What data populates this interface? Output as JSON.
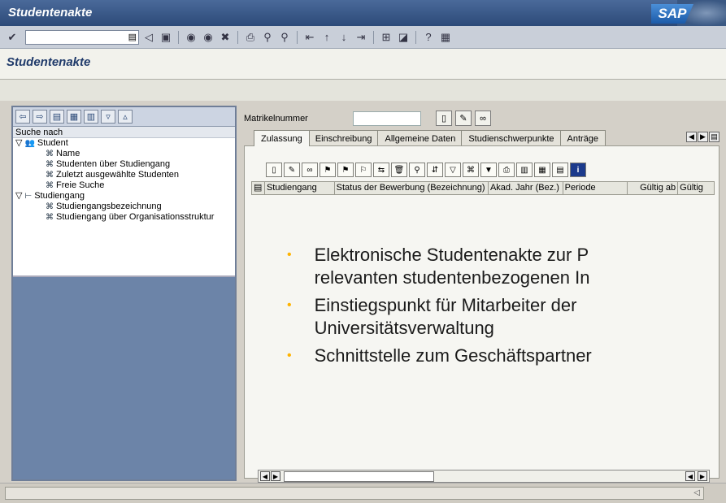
{
  "window": {
    "title": "Studentenakte",
    "logo": "SAP"
  },
  "toolbar": {
    "icons": [
      "enter-icon",
      "dropdown-icon",
      "back-arrow-icon",
      "save-icon",
      "back-icon",
      "exit-icon",
      "cancel-icon",
      "print-icon",
      "find-icon",
      "find-next-icon",
      "first-page-icon",
      "prev-page-icon",
      "next-page-icon",
      "last-page-icon",
      "new-session-icon",
      "shortcut-icon",
      "help-icon",
      "layout-icon"
    ]
  },
  "screen_title": "Studentenakte",
  "left": {
    "search_label": "Suche nach",
    "tree": [
      {
        "label": "Student",
        "level": 0,
        "icon": "student-icon"
      },
      {
        "label": "Name",
        "level": 1,
        "icon": "binoculars-icon"
      },
      {
        "label": "Studenten über Studiengang",
        "level": 1,
        "icon": "binoculars-icon"
      },
      {
        "label": "Zuletzt ausgewählte Studenten",
        "level": 1,
        "icon": "binoculars-icon"
      },
      {
        "label": "Freie Suche",
        "level": 1,
        "icon": "binoculars-icon"
      },
      {
        "label": "Studiengang",
        "level": 0,
        "icon": "structure-icon"
      },
      {
        "label": "Studiengangsbezeichnung",
        "level": 1,
        "icon": "binoculars-icon"
      },
      {
        "label": "Studiengang über Organisationsstruktur",
        "level": 1,
        "icon": "binoculars-icon"
      }
    ]
  },
  "right": {
    "matrikel_label": "Matrikelnummer",
    "matrikel_value": "",
    "tabs": [
      "Zulassung",
      "Einschreibung",
      "Allgemeine Daten",
      "Studienschwerpunkte",
      "Anträge"
    ],
    "active_tab": "Zulassung",
    "columns": [
      "Studiengang",
      "Status der Bewerbung (Bezeichnung)",
      "Akad. Jahr (Bez.)",
      "Periode",
      "Gültig ab",
      "Gültig"
    ],
    "bullets": [
      {
        "line1": "Elektronische Studentenakte zur P",
        "line2": "relevanten studentenbezogenen In"
      },
      {
        "line1": "Einstiegspunkt für Mitarbeiter der",
        "line2": "Universitätsverwaltung"
      },
      {
        "line1": "Schnittstelle zum Geschäftspartner",
        "line2": ""
      }
    ]
  },
  "colors": {
    "accent": "#ffb300",
    "titlebar": "#2c4a78"
  }
}
